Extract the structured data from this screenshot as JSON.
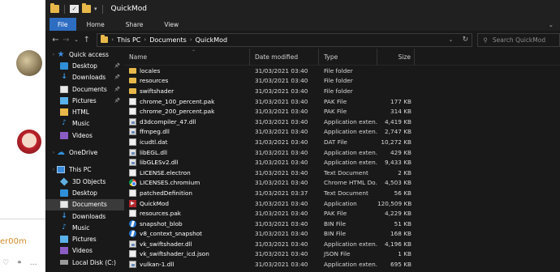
{
  "background": {
    "text": "er00m"
  },
  "window": {
    "title": "QuickMod"
  },
  "ribbon": {
    "tabs": [
      "File",
      "Home",
      "Share",
      "View"
    ]
  },
  "address": {
    "crumbs": [
      "This PC",
      "Documents",
      "QuickMod"
    ],
    "search_placeholder": "Search QuickMod"
  },
  "nav": {
    "items": [
      {
        "label": "Quick access",
        "icon": "star-icon",
        "indent": 0,
        "pinned": false,
        "chev": true
      },
      {
        "label": "Desktop",
        "icon": "desktop-icon",
        "indent": 1,
        "pinned": true
      },
      {
        "label": "Downloads",
        "icon": "download-icon",
        "indent": 1,
        "pinned": true
      },
      {
        "label": "Documents",
        "icon": "documents-icon",
        "indent": 1,
        "pinned": true
      },
      {
        "label": "Pictures",
        "icon": "pictures-icon",
        "indent": 1,
        "pinned": true
      },
      {
        "label": "HTML",
        "icon": "folder-icon",
        "indent": 1,
        "pinned": false
      },
      {
        "label": "Music",
        "icon": "music-icon",
        "indent": 1,
        "pinned": false
      },
      {
        "label": "Videos",
        "icon": "videos-icon",
        "indent": 1,
        "pinned": false
      },
      {
        "label": "",
        "icon": "",
        "indent": 0,
        "spacer": true
      },
      {
        "label": "OneDrive",
        "icon": "cloud-icon",
        "indent": 0,
        "chev": true
      },
      {
        "label": "",
        "icon": "",
        "indent": 0,
        "spacer": true
      },
      {
        "label": "This PC",
        "icon": "pc-icon",
        "indent": 0,
        "chev": true
      },
      {
        "label": "3D Objects",
        "icon": "3d-objects-icon",
        "indent": 1
      },
      {
        "label": "Desktop",
        "icon": "desktop-icon",
        "indent": 1
      },
      {
        "label": "Documents",
        "icon": "documents-icon",
        "indent": 1,
        "selected": true
      },
      {
        "label": "Downloads",
        "icon": "download-icon",
        "indent": 1
      },
      {
        "label": "Music",
        "icon": "music-icon",
        "indent": 1
      },
      {
        "label": "Pictures",
        "icon": "pictures-icon",
        "indent": 1
      },
      {
        "label": "Videos",
        "icon": "videos-icon",
        "indent": 1
      },
      {
        "label": "Local Disk (C:)",
        "icon": "disk-icon",
        "indent": 1
      }
    ]
  },
  "columns": {
    "name": "Name",
    "date": "Date modified",
    "type": "Type",
    "size": "Size"
  },
  "files": [
    {
      "name": "locales",
      "date": "31/03/2021 03:40",
      "type": "File folder",
      "size": "",
      "icon": "folder"
    },
    {
      "name": "resources",
      "date": "31/03/2021 03:40",
      "type": "File folder",
      "size": "",
      "icon": "folder"
    },
    {
      "name": "swiftshader",
      "date": "31/03/2021 03:40",
      "type": "File folder",
      "size": "",
      "icon": "folder"
    },
    {
      "name": "chrome_100_percent.pak",
      "date": "31/03/2021 03:40",
      "type": "PAK File",
      "size": "177 KB",
      "icon": "file"
    },
    {
      "name": "chrome_200_percent.pak",
      "date": "31/03/2021 03:40",
      "type": "PAK File",
      "size": "314 KB",
      "icon": "file"
    },
    {
      "name": "d3dcompiler_47.dll",
      "date": "31/03/2021 03:40",
      "type": "Application exten...",
      "size": "4,419 KB",
      "icon": "dll"
    },
    {
      "name": "ffmpeg.dll",
      "date": "31/03/2021 03:40",
      "type": "Application exten...",
      "size": "2,747 KB",
      "icon": "dll"
    },
    {
      "name": "icudtl.dat",
      "date": "31/03/2021 03:40",
      "type": "DAT File",
      "size": "10,272 KB",
      "icon": "file"
    },
    {
      "name": "libEGL.dll",
      "date": "31/03/2021 03:40",
      "type": "Application exten...",
      "size": "429 KB",
      "icon": "dll"
    },
    {
      "name": "libGLESv2.dll",
      "date": "31/03/2021 03:40",
      "type": "Application exten...",
      "size": "9,433 KB",
      "icon": "dll"
    },
    {
      "name": "LICENSE.electron",
      "date": "31/03/2021 03:40",
      "type": "Text Document",
      "size": "2 KB",
      "icon": "file"
    },
    {
      "name": "LICENSES.chromium",
      "date": "31/03/2021 03:40",
      "type": "Chrome HTML Do...",
      "size": "4,503 KB",
      "icon": "chrome"
    },
    {
      "name": "patchedDefinition",
      "date": "31/03/2021 03:37",
      "type": "Text Document",
      "size": "56 KB",
      "icon": "file"
    },
    {
      "name": "QuickMod",
      "date": "31/03/2021 03:40",
      "type": "Application",
      "size": "120,509 KB",
      "icon": "app"
    },
    {
      "name": "resources.pak",
      "date": "31/03/2021 03:40",
      "type": "PAK File",
      "size": "4,229 KB",
      "icon": "file"
    },
    {
      "name": "snapshot_blob",
      "date": "31/03/2021 03:40",
      "type": "BIN File",
      "size": "51 KB",
      "icon": "blob"
    },
    {
      "name": "v8_context_snapshot",
      "date": "31/03/2021 03:40",
      "type": "BIN File",
      "size": "168 KB",
      "icon": "blob"
    },
    {
      "name": "vk_swiftshader.dll",
      "date": "31/03/2021 03:40",
      "type": "Application exten...",
      "size": "4,196 KB",
      "icon": "dll"
    },
    {
      "name": "vk_swiftshader_icd.json",
      "date": "31/03/2021 03:40",
      "type": "JSON File",
      "size": "1 KB",
      "icon": "file"
    },
    {
      "name": "vulkan-1.dll",
      "date": "31/03/2021 03:40",
      "type": "Application exten...",
      "size": "695 KB",
      "icon": "dll"
    }
  ]
}
